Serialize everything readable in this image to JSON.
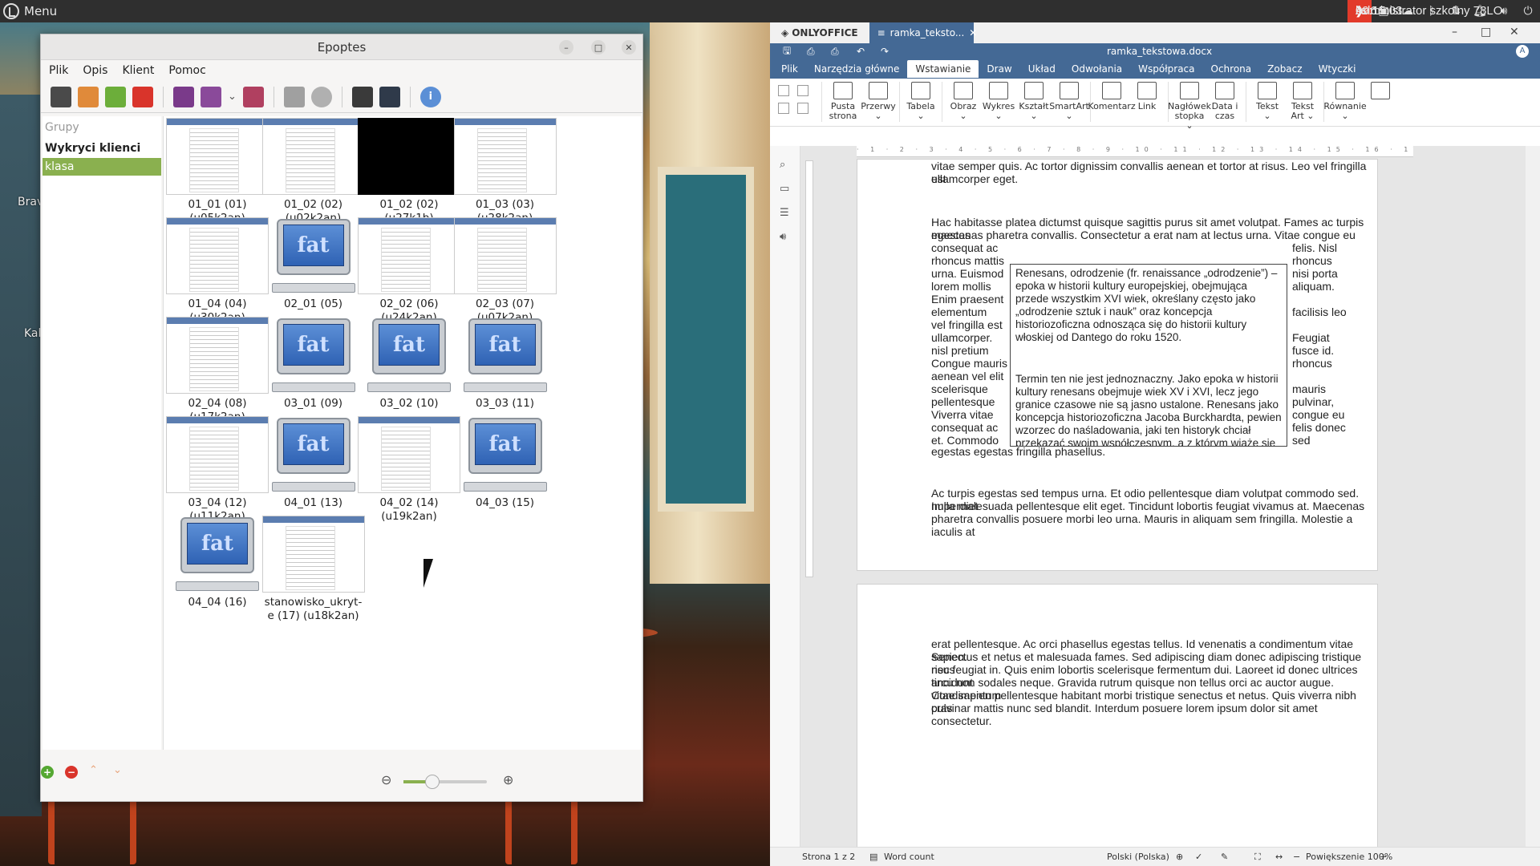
{
  "panel": {
    "menu_label": "Menu",
    "date": "lis 6",
    "time": "09:15:03",
    "user": "Administrator szkolny 78LO"
  },
  "desktop": {
    "labels": [
      "Brav",
      "Kal"
    ]
  },
  "epoptes": {
    "title": "Epoptes",
    "menu": [
      "Plik",
      "Opis",
      "Klient",
      "Pomoc"
    ],
    "groups_header": "Grupy",
    "detected": "Wykryci klienci",
    "selected_group": "klasa",
    "clients": [
      {
        "name": "01_01 (01)",
        "user": "(u05k2an)",
        "thumb": "doc"
      },
      {
        "name": "01_02 (02)",
        "user": "(u02k2an)",
        "thumb": "doc"
      },
      {
        "name": "01_02 (02)",
        "user": "(u27k1b)",
        "thumb": "black"
      },
      {
        "name": "01_03 (03)",
        "user": "(u28k2an)",
        "thumb": "doc"
      },
      {
        "name": "01_04 (04)",
        "user": "(u30k2an)",
        "thumb": "doc"
      },
      {
        "name": "02_01 (05)",
        "user": "",
        "thumb": "fat"
      },
      {
        "name": "02_02 (06)",
        "user": "(u24k2an)",
        "thumb": "doc"
      },
      {
        "name": "02_03 (07)",
        "user": "(u07k2an)",
        "thumb": "doc"
      },
      {
        "name": "02_04 (08)",
        "user": "(u17k2an)",
        "thumb": "doc"
      },
      {
        "name": "03_01 (09)",
        "user": "",
        "thumb": "fat"
      },
      {
        "name": "03_02 (10)",
        "user": "",
        "thumb": "fat"
      },
      {
        "name": "03_03 (11)",
        "user": "",
        "thumb": "fat"
      },
      {
        "name": "03_04 (12)",
        "user": "(u11k2an)",
        "thumb": "doc"
      },
      {
        "name": "04_01 (13)",
        "user": "",
        "thumb": "fat"
      },
      {
        "name": "04_02 (14)",
        "user": "(u19k2an)",
        "thumb": "doc"
      },
      {
        "name": "04_03 (15)",
        "user": "",
        "thumb": "fat"
      },
      {
        "name": "04_04 (16)",
        "user": "",
        "thumb": "fat"
      },
      {
        "name": "stanowisko_ukryt-",
        "user": "e (17) (u18k2an)",
        "thumb": "doc"
      }
    ],
    "fat_label": "fat",
    "zoom_level": 0.35
  },
  "onlyoffice": {
    "brand": "ONLYOFFICE",
    "tab_title": "ramka_teksto...",
    "doc_title": "ramka_tekstowa.docx",
    "avatar": "A",
    "menus": [
      "Plik",
      "Narzędzia główne",
      "Wstawianie",
      "Draw",
      "Układ",
      "Odwołania",
      "Współpraca",
      "Ochrona",
      "Zobacz",
      "Wtyczki"
    ],
    "active_menu": "Wstawianie",
    "ribbon": [
      {
        "l1": "Pusta",
        "l2": "strona"
      },
      {
        "l1": "Przerwy",
        "l2": "⌄"
      },
      {
        "l1": "Tabela",
        "l2": "⌄"
      },
      {
        "l1": "Obraz",
        "l2": "⌄"
      },
      {
        "l1": "Wykres",
        "l2": "⌄"
      },
      {
        "l1": "Kształt",
        "l2": "⌄"
      },
      {
        "l1": "SmartArt",
        "l2": "⌄"
      },
      {
        "l1": "Komentarz",
        "l2": ""
      },
      {
        "l1": "Link",
        "l2": ""
      },
      {
        "l1": "Nagłówek",
        "l2": "stopka ⌄"
      },
      {
        "l1": "Data i",
        "l2": "czas"
      },
      {
        "l1": "Tekst",
        "l2": "⌄"
      },
      {
        "l1": "Tekst",
        "l2": "Art ⌄"
      },
      {
        "l1": "Równanie",
        "l2": "⌄"
      },
      {
        "l1": "",
        "l2": ""
      }
    ],
    "ruler_numbers": "· 1 · 2 · 3 · 4 · 5 · 6 · 7 · 8 · 9 · 10 · 11 · 12 · 13 · 14 · 15 · 16 · 17",
    "para1a": "vitae semper quis. Ac tortor dignissim convallis aenean et tortor at risus. Leo vel fringilla est",
    "para1b": "ullamcorper eget.",
    "para2a": "Hac habitasse platea dictumst quisque sagittis purus sit amet volutpat. Fames ac turpis egestas",
    "para2b": "maecenas pharetra convallis. Consectetur a erat nam at lectus urna. Vitae congue eu",
    "left_col": [
      "consequat ac",
      "rhoncus mattis",
      "urna. Euismod",
      "lorem mollis",
      "Enim praesent",
      "elementum",
      "vel fringilla est",
      "ullamcorper.",
      "nisl pretium",
      "Congue mauris",
      "aenean vel elit",
      "scelerisque",
      "pellentesque",
      "Viverra vitae",
      "consequat ac",
      "et. Commodo"
    ],
    "right_col": [
      "felis. Nisl",
      "rhoncus",
      "nisi porta",
      "aliquam.",
      "",
      "facilisis leo",
      "",
      "Feugiat",
      "fusce id.",
      "rhoncus",
      "",
      "mauris",
      "pulvinar,",
      "congue eu",
      "felis donec",
      "sed"
    ],
    "para2c": "egestas egestas fringilla phasellus.",
    "textbox_p1": "Renesans, odrodzenie (fr. renaissance „odrodzenie”) – epoka w historii kultury europejskiej, obejmująca przede wszystkim XVI wiek, określany często jako „odrodzenie sztuk i nauk” oraz koncepcja historiozoficzna odnosząca się do historii kultury włoskiej od Dantego do roku 1520.",
    "textbox_p2": "Termin ten nie jest jednoznaczny. Jako epoka w historii kultury renesans obejmuje wiek XV i XVI, lecz jego granice czasowe nie są jasno ustalone. Renesans jako koncepcja historiozoficzna Jacoba Burckhardta, pewien wzorzec do naśladowania, jaki ten historyk chciał przekazać swoim współczesnym, a z którym wiąże się do dziś popularne i „szkolne” rozumienie tej epoki, jest już przestarzały.",
    "para3a": "Ac turpis egestas sed tempus urna. Et odio pellentesque diam volutpat commodo sed. Imperdiet",
    "para3b": "nulla malesuada pellentesque elit eget. Tincidunt lobortis feugiat vivamus at. Maecenas",
    "para3c": "pharetra convallis posuere morbi leo urna. Mauris in aliquam sem fringilla. Molestie a iaculis at",
    "page2": [
      "erat pellentesque. Ac orci phasellus egestas tellus. Id venenatis a condimentum vitae sapien.",
      "Senectus et netus et malesuada fames. Sed adipiscing diam donec adipiscing tristique risus",
      "nec feugiat in. Quis enim lobortis scelerisque fermentum dui. Laoreet id donec ultrices tincidunt",
      "arcu non sodales neque. Gravida rutrum quisque non tellus orci ac auctor augue. Condimentum",
      "vitae sapien pellentesque habitant morbi tristique senectus et netus. Quis viverra nibh cras",
      "pulvinar mattis nunc sed blandit. Interdum posuere lorem ipsum dolor sit amet consectetur."
    ],
    "status": {
      "page": "Strona 1 z 2",
      "word_count": "Word count",
      "lang": "Polski (Polska)",
      "zoom": "Powiększenie 100%"
    }
  },
  "colors": {
    "panel": "#2f2f2f",
    "epoptes_accent": "#8ab04f",
    "onlyoffice_header": "#446995"
  }
}
